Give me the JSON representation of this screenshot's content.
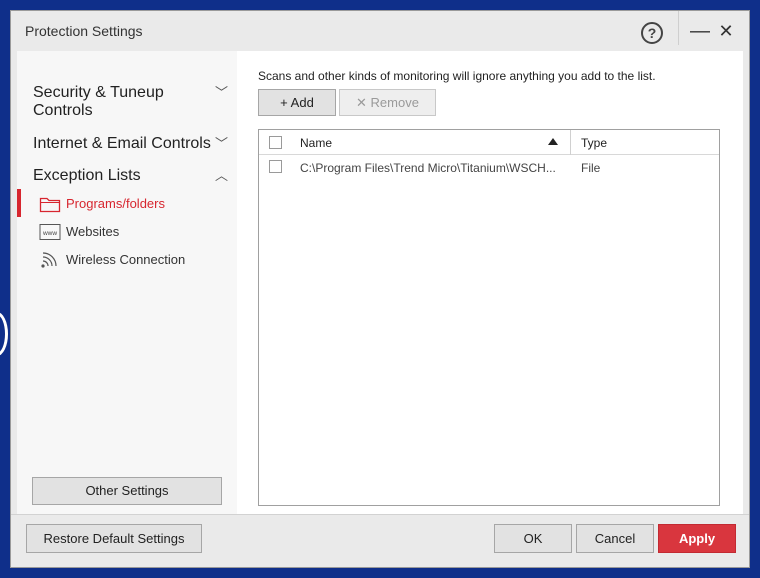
{
  "window": {
    "title": "Protection Settings",
    "help_glyph": "?",
    "minimize_glyph": "—",
    "close_glyph": "✕"
  },
  "sidebar": {
    "groups": [
      {
        "label": "Security & Tuneup Controls",
        "icon": "chevron-down-icon",
        "chevron": "﹀"
      },
      {
        "label": "Internet & Email Controls",
        "icon": "chevron-down-icon",
        "chevron": "﹀"
      },
      {
        "label": "Exception Lists",
        "icon": "chevron-up-icon",
        "chevron": "︿"
      }
    ],
    "sub_items": [
      {
        "label": "Programs/folders",
        "icon": "folder-icon",
        "active": true
      },
      {
        "label": "Websites",
        "icon": "www-icon",
        "active": false
      },
      {
        "label": "Wireless Connection",
        "icon": "wifi-icon",
        "active": false
      }
    ],
    "other_settings_label": "Other Settings"
  },
  "main": {
    "description": "Scans and other kinds of monitoring will ignore anything you add to the list.",
    "add_label": "Add",
    "add_glyph": "+",
    "remove_label": "Remove",
    "remove_glyph": "✕",
    "table": {
      "columns": [
        "Name",
        "Type"
      ],
      "sort_column": "Name",
      "sort_direction": "ascending",
      "rows": [
        {
          "name": "C:\\Program Files\\Trend Micro\\Titanium\\WSCH...",
          "type": "File",
          "checked": false
        }
      ]
    }
  },
  "footer": {
    "restore_label": "Restore Default Settings",
    "ok_label": "OK",
    "cancel_label": "Cancel",
    "apply_label": "Apply"
  },
  "colors": {
    "accent": "#d7262f",
    "apply_button": "#d9363e",
    "desktop_background": "#0f2f8a"
  }
}
